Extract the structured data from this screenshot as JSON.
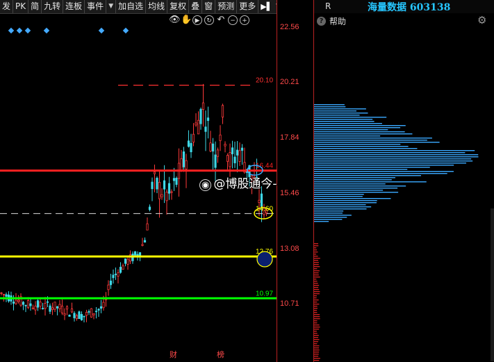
{
  "toolbar": {
    "items": [
      "发",
      "PK",
      "简",
      "九转",
      "连板",
      "事件",
      "加自选",
      "均线",
      "复权",
      "叠",
      "窗",
      "预测",
      "更多"
    ],
    "dropdown_after": "事件"
  },
  "chart_icons": [
    "eye-icon",
    "hand-icon",
    "play-icon",
    "reset-icon",
    "undo-icon",
    "zoom-out-icon",
    "zoom-in-icon"
  ],
  "price_axis": [
    "22.56",
    "20.21",
    "17.84",
    "15.46",
    "13.08",
    "10.71"
  ],
  "levels": [
    {
      "label": "20.10",
      "color": "#ff3030",
      "style": "dashed"
    },
    {
      "label": "16.44",
      "color": "#ff2020",
      "style": "solid"
    },
    {
      "label": "14.60",
      "color": "#ffff00",
      "style": "dashed-white"
    },
    {
      "label": "12.76",
      "color": "#ffff00",
      "style": "solid"
    },
    {
      "label": "10.97",
      "color": "#00ff00",
      "style": "solid"
    }
  ],
  "watermark": "@博股通今-",
  "bottom_markers": [
    "财",
    "榜"
  ],
  "side_panel": {
    "r_label": "R",
    "title": "海量数据 603138",
    "help": "帮助"
  },
  "colors": {
    "up": "#ff3a3a",
    "down": "#3ed7e6",
    "profile": "#3aa8ff",
    "diamond": "#44aaff"
  }
}
